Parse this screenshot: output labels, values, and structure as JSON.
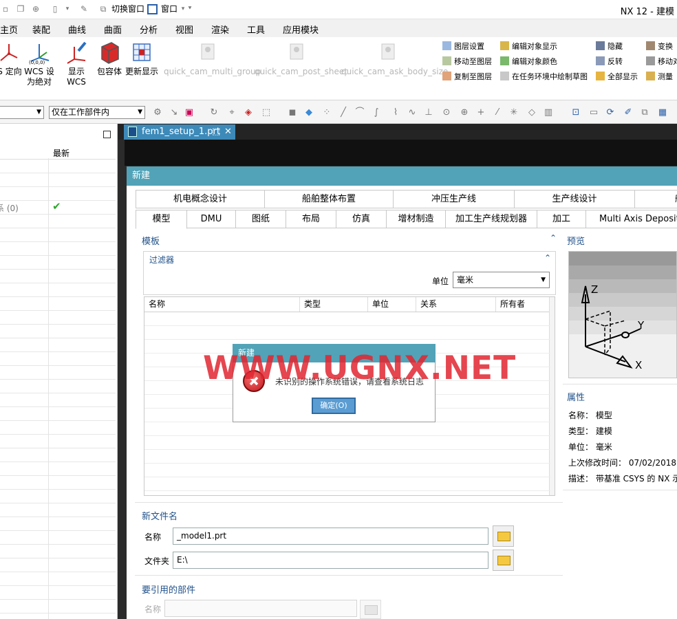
{
  "titlebar": {
    "switch_window": "切换窗口",
    "window_menu": "窗口",
    "app_title": "NX 12 - 建模"
  },
  "menubar": [
    "主页",
    "装配",
    "曲线",
    "曲面",
    "分析",
    "视图",
    "渲染",
    "工具",
    "应用模块"
  ],
  "ribbon": {
    "buttons": [
      {
        "label": "S 定向",
        "icon": "wcs-orient-icon"
      },
      {
        "label": "WCS 设\n为绝对",
        "icon": "wcs-absolute-icon"
      },
      {
        "label": "显示 WCS",
        "icon": "display-wcs-icon"
      },
      {
        "label": "包容体",
        "icon": "bounding-body-icon"
      },
      {
        "label": "更新显示",
        "icon": "update-display-icon"
      },
      {
        "label": "quick_cam_multi_group",
        "icon": "placeholder-icon",
        "disabled": true
      },
      {
        "label": "quick_cam_post_sheet",
        "icon": "placeholder-icon",
        "disabled": true
      },
      {
        "label": "quick_cam_ask_body_size",
        "icon": "placeholder-icon",
        "disabled": true
      }
    ],
    "small_col1": [
      "图层设置",
      "移动至图层",
      "复制至图层"
    ],
    "small_col2": [
      "编辑对象显示",
      "编辑对象颜色",
      "在任务环境中绘制草图"
    ],
    "small_col3": [
      "隐藏",
      "反转",
      "全部显示"
    ],
    "small_col4": [
      "变换",
      "移动对",
      "测量"
    ]
  },
  "toolbar2": {
    "scope_select": "仅在工作部件内"
  },
  "leftpanel": {
    "col_latest": "最新",
    "row_label": "系 (0)",
    "check": "✔"
  },
  "doc_tab": {
    "label": "fem1_setup_1.prt"
  },
  "new_dialog": {
    "title": "新建",
    "tabs_row1": [
      "机电概念设计",
      "船舶整体布置",
      "冲压生产线",
      "生产线设计",
      "船"
    ],
    "tabs_row2": [
      "模型",
      "DMU",
      "图纸",
      "布局",
      "仿真",
      "增材制造",
      "加工生产线规划器",
      "加工",
      "Multi Axis Deposition"
    ],
    "active_tab": "模型",
    "template_section": "模板",
    "filter_label": "过滤器",
    "unit_label": "单位",
    "unit_value": "毫米",
    "grid_headers": [
      "名称",
      "类型",
      "单位",
      "关系",
      "所有者"
    ],
    "new_filename_section": "新文件名",
    "name_label": "名称",
    "name_value": "_model1.prt",
    "folder_label": "文件夹",
    "folder_value": "E:\\",
    "ref_part_section": "要引用的部件",
    "ref_name_label": "名称",
    "preview_section": "预览",
    "properties_section": "属性",
    "properties": [
      {
        "key": "名称：",
        "value": "模型"
      },
      {
        "key": "类型：",
        "value": "建模"
      },
      {
        "key": "单位：",
        "value": "毫米"
      },
      {
        "key": "上次修改时间：",
        "value": "07/02/2018"
      },
      {
        "key": "描述：",
        "value": "带基准 CSYS 的 NX 示"
      }
    ],
    "axes": {
      "z": "Z",
      "y": "Y",
      "x": "X"
    }
  },
  "error_dialog": {
    "title": "新建",
    "message": "未识别的操作系统错误，请查看系统日志",
    "ok_label": "确定(O)"
  },
  "watermark": "WWW.UGNX.NET",
  "colors": {
    "dialog_title_bar": "#52a3b7",
    "section_text": "#22528a",
    "ok_button": "#5b9dd3",
    "watermark_red": "#e02630"
  }
}
